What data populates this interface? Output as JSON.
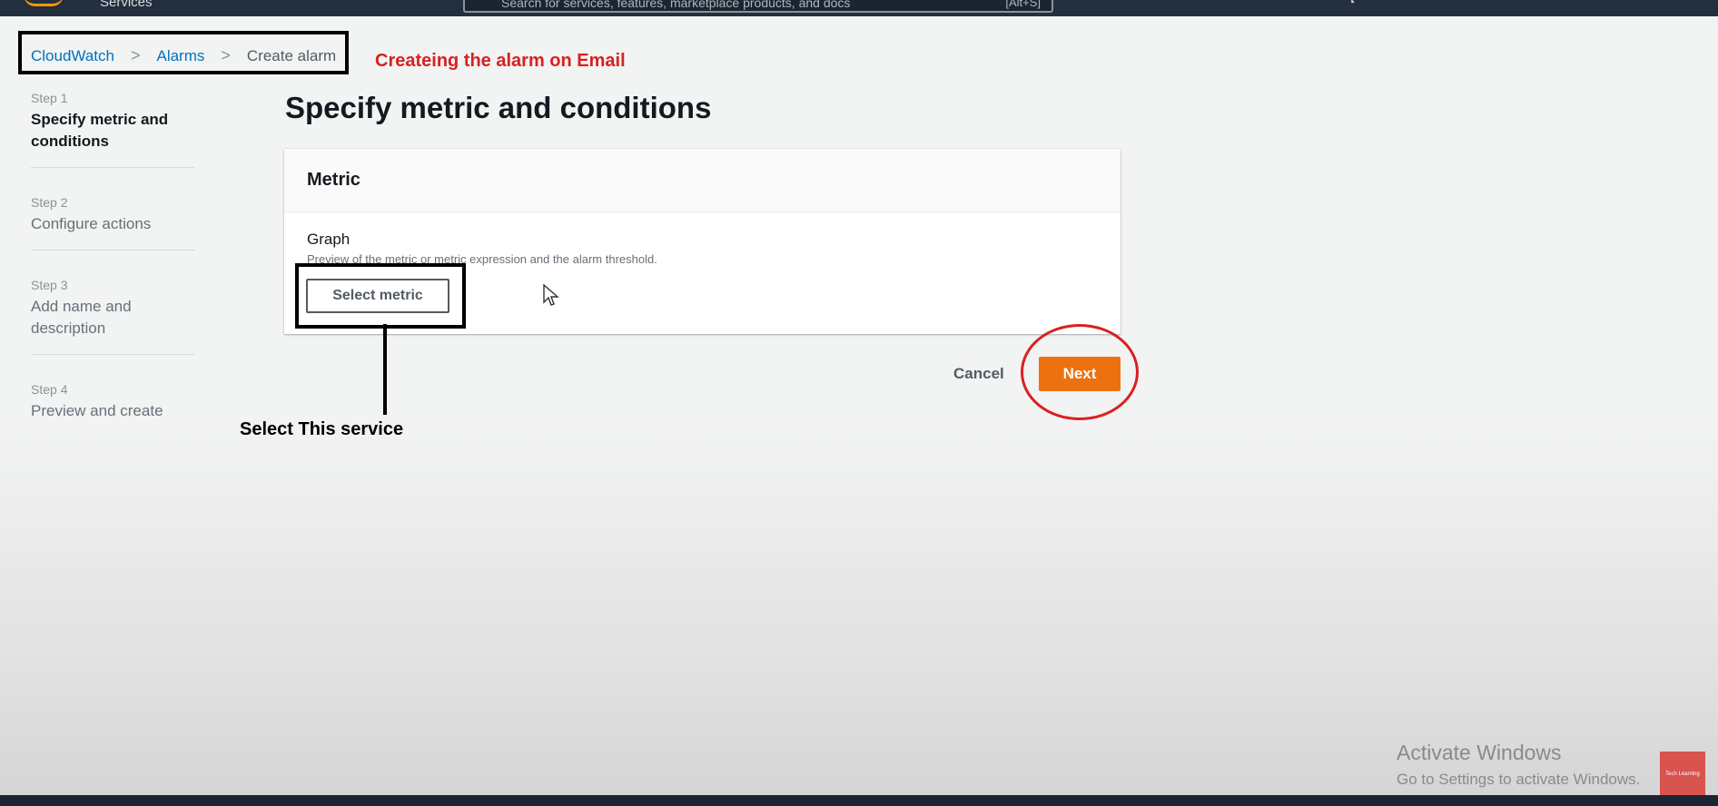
{
  "topbar": {
    "services_label": "Services",
    "search_placeholder": "Search for services, features, marketplace products, and docs",
    "search_shortcut": "[Alt+S]"
  },
  "breadcrumb": {
    "items": [
      "CloudWatch",
      "Alarms",
      "Create alarm"
    ]
  },
  "annotations": {
    "top_note": "Createing the alarm on Email",
    "select_note": "Select This service"
  },
  "steps": [
    {
      "num": "Step 1",
      "title": "Specify metric and conditions"
    },
    {
      "num": "Step 2",
      "title": "Configure actions"
    },
    {
      "num": "Step 3",
      "title": "Add name and description"
    },
    {
      "num": "Step 4",
      "title": "Preview and create"
    }
  ],
  "main": {
    "title": "Specify metric and conditions",
    "panel_title": "Metric",
    "graph_label": "Graph",
    "graph_desc": "Preview of the metric or metric expression and the alarm threshold.",
    "select_metric": "Select metric",
    "cancel": "Cancel",
    "next": "Next"
  },
  "watermark": {
    "line1": "Activate Windows",
    "line2": "Go to Settings to activate Windows.",
    "badge": "Tech Learning"
  },
  "colors": {
    "accent": "#ec7211",
    "link": "#0073bb",
    "annotation_red": "#d9211f",
    "topbar": "#232f3e"
  }
}
